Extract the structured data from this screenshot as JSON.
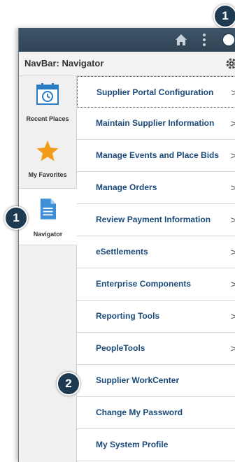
{
  "header": {
    "title": "NavBar: Navigator",
    "icons": [
      "home-icon",
      "actions-icon",
      "navbar-icon",
      "gear-icon"
    ]
  },
  "sidebar": {
    "items": [
      {
        "label": "Recent Places",
        "icon": "calendar-clock-icon"
      },
      {
        "label": "My Favorites",
        "icon": "star-icon"
      },
      {
        "label": "Navigator",
        "icon": "document-icon",
        "active": true
      }
    ]
  },
  "menu": {
    "items": [
      {
        "label": "Supplier Portal Configuration",
        "chevron": ">"
      },
      {
        "label": "Maintain Supplier Information",
        "chevron": ">"
      },
      {
        "label": "Manage Events and Place Bids",
        "chevron": ">"
      },
      {
        "label": "Manage Orders",
        "chevron": ">"
      },
      {
        "label": "Review Payment Information",
        "chevron": ">"
      },
      {
        "label": "eSettlements",
        "chevron": ">"
      },
      {
        "label": "Enterprise Components",
        "chevron": ">"
      },
      {
        "label": "Reporting Tools",
        "chevron": ">"
      },
      {
        "label": "PeopleTools",
        "chevron": ">"
      },
      {
        "label": "Supplier WorkCenter",
        "chevron": ""
      },
      {
        "label": "Change My Password",
        "chevron": ""
      },
      {
        "label": "My System Profile",
        "chevron": ""
      }
    ]
  },
  "callouts": {
    "navbar": "1",
    "navigator": "1",
    "workcenter": "2"
  },
  "colors": {
    "topbar": "#2e4354",
    "link": "#1b4a79",
    "star": "#f39c1a",
    "document": "#3f8fd8",
    "callout": "#1e3a52"
  }
}
